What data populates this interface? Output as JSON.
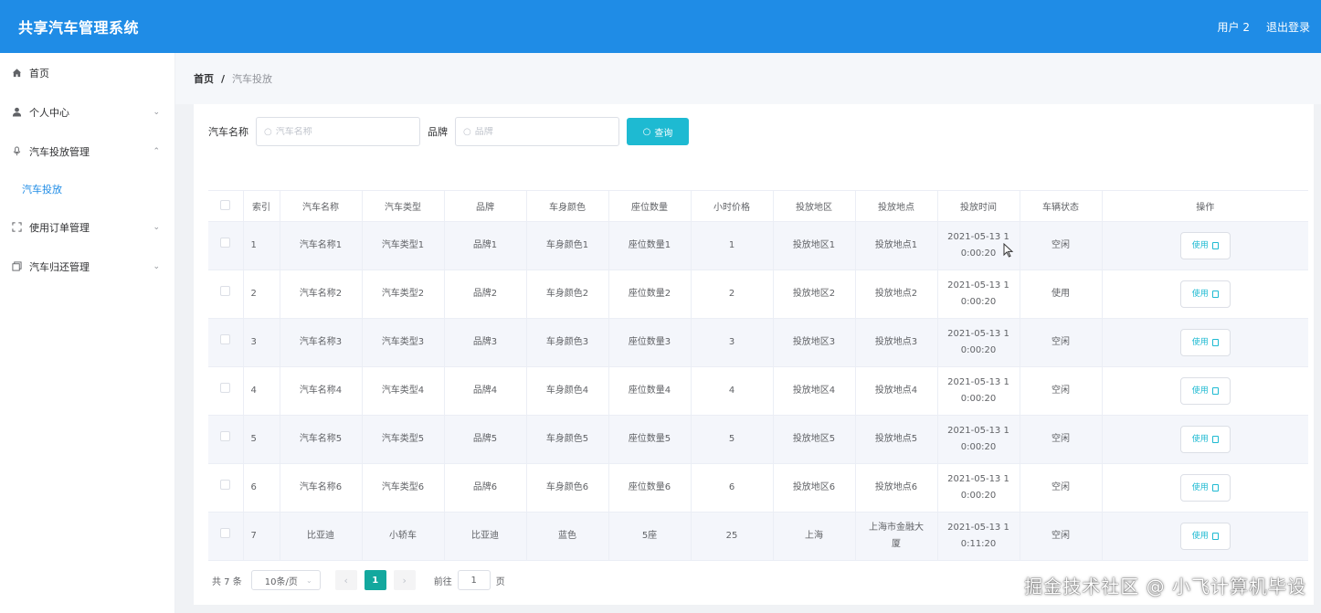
{
  "header": {
    "app_title": "共享汽车管理系统",
    "user_label": "用户 2",
    "logout_label": "退出登录"
  },
  "sidebar": {
    "items": [
      {
        "label": "首页",
        "icon": "home-icon",
        "chevron": ""
      },
      {
        "label": "个人中心",
        "icon": "user-icon",
        "chevron": "⌄"
      },
      {
        "label": "汽车投放管理",
        "icon": "microphone-icon",
        "chevron": "⌃"
      },
      {
        "label": "使用订单管理",
        "icon": "scan-icon",
        "chevron": "⌄"
      },
      {
        "label": "汽车归还管理",
        "icon": "copy-icon",
        "chevron": "⌄"
      }
    ],
    "submenu": {
      "label": "汽车投放"
    }
  },
  "breadcrumb": {
    "home": "首页",
    "separator": "/",
    "current": "汽车投放"
  },
  "search": {
    "name_label": "汽车名称",
    "name_placeholder": "汽车名称",
    "brand_label": "品牌",
    "brand_placeholder": "品牌",
    "query_label": "查询"
  },
  "table": {
    "headers": [
      "",
      "索引",
      "汽车名称",
      "汽车类型",
      "品牌",
      "车身颜色",
      "座位数量",
      "小时价格",
      "投放地区",
      "投放地点",
      "投放时间",
      "车辆状态",
      "操作"
    ],
    "action_label": "使用",
    "rows": [
      {
        "index": "1",
        "name": "汽车名称1",
        "type": "汽车类型1",
        "brand": "品牌1",
        "color": "车身颜色1",
        "seats": "座位数量1",
        "price": "1",
        "region": "投放地区1",
        "location": "投放地点1",
        "time_line1": "2021-05-13 1",
        "time_line2": "0:00:20",
        "status": "空闲"
      },
      {
        "index": "2",
        "name": "汽车名称2",
        "type": "汽车类型2",
        "brand": "品牌2",
        "color": "车身颜色2",
        "seats": "座位数量2",
        "price": "2",
        "region": "投放地区2",
        "location": "投放地点2",
        "time_line1": "2021-05-13 1",
        "time_line2": "0:00:20",
        "status": "使用"
      },
      {
        "index": "3",
        "name": "汽车名称3",
        "type": "汽车类型3",
        "brand": "品牌3",
        "color": "车身颜色3",
        "seats": "座位数量3",
        "price": "3",
        "region": "投放地区3",
        "location": "投放地点3",
        "time_line1": "2021-05-13 1",
        "time_line2": "0:00:20",
        "status": "空闲"
      },
      {
        "index": "4",
        "name": "汽车名称4",
        "type": "汽车类型4",
        "brand": "品牌4",
        "color": "车身颜色4",
        "seats": "座位数量4",
        "price": "4",
        "region": "投放地区4",
        "location": "投放地点4",
        "time_line1": "2021-05-13 1",
        "time_line2": "0:00:20",
        "status": "空闲"
      },
      {
        "index": "5",
        "name": "汽车名称5",
        "type": "汽车类型5",
        "brand": "品牌5",
        "color": "车身颜色5",
        "seats": "座位数量5",
        "price": "5",
        "region": "投放地区5",
        "location": "投放地点5",
        "time_line1": "2021-05-13 1",
        "time_line2": "0:00:20",
        "status": "空闲"
      },
      {
        "index": "6",
        "name": "汽车名称6",
        "type": "汽车类型6",
        "brand": "品牌6",
        "color": "车身颜色6",
        "seats": "座位数量6",
        "price": "6",
        "region": "投放地区6",
        "location": "投放地点6",
        "time_line1": "2021-05-13 1",
        "time_line2": "0:00:20",
        "status": "空闲"
      },
      {
        "index": "7",
        "name": "比亚迪",
        "type": "小轿车",
        "brand": "比亚迪",
        "color": "蓝色",
        "seats": "5座",
        "price": "25",
        "region": "上海",
        "location": "上海市金融大厦",
        "time_line1": "2021-05-13 1",
        "time_line2": "0:11:20",
        "status": "空闲"
      }
    ]
  },
  "pagination": {
    "total": "共 7 条",
    "page_size": "10条/页",
    "prev": "‹",
    "current_page": "1",
    "next": "›",
    "goto_label": "前往",
    "goto_value": "1",
    "goto_unit": "页"
  },
  "watermark": "掘金技术社区 @ 小飞计算机毕设",
  "colors": {
    "header_bg": "#1f8ce6",
    "accent": "#1ebad2",
    "active_page": "#13a89e",
    "active_menu": "#1f8ce6"
  }
}
